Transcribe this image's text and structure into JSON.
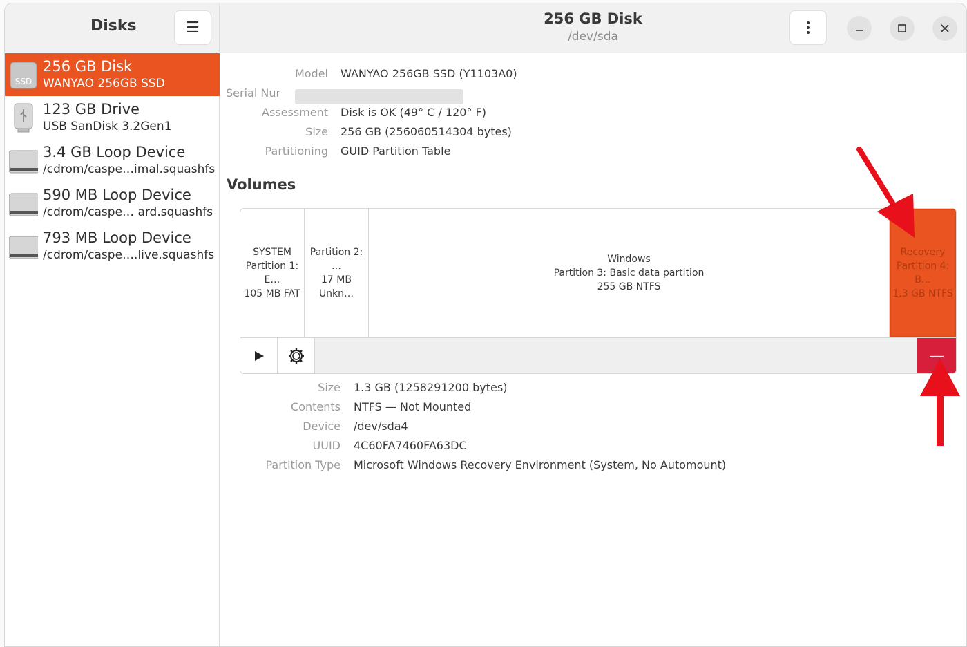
{
  "sidebar": {
    "title": "Disks",
    "drives": [
      {
        "name": "256 GB Disk",
        "sub": "WANYAO 256GB SSD",
        "icon": "ssd-icon",
        "icon_text": "SSD"
      },
      {
        "name": "123 GB Drive",
        "sub": "USB SanDisk 3.2Gen1",
        "icon": "usb-drive-icon"
      },
      {
        "name": "3.4 GB Loop Device",
        "sub": "/cdrom/caspe…imal.squashfs",
        "icon": "loop-device-icon"
      },
      {
        "name": "590 MB Loop Device",
        "sub": "/cdrom/caspe… ard.squashfs",
        "icon": "loop-device-icon"
      },
      {
        "name": "793 MB Loop Device",
        "sub": "/cdrom/caspe….live.squashfs",
        "icon": "loop-device-icon"
      }
    ]
  },
  "header": {
    "title": "256 GB Disk",
    "subtitle": "/dev/sda"
  },
  "disk_info": {
    "model_label": "Model",
    "model_value": "WANYAO 256GB SSD (Y1103A0)",
    "serial_label": "Serial Nur",
    "assessment_label": "Assessment",
    "assessment_value": "Disk is OK (49° C / 120° F)",
    "size_label": "Size",
    "size_value": "256 GB (256060514304 bytes)",
    "partitioning_label": "Partitioning",
    "partitioning_value": "GUID Partition Table"
  },
  "volumes": {
    "title": "Volumes",
    "partitions": [
      {
        "line1": "SYSTEM",
        "line2": "Partition 1: E…",
        "line3": "105 MB FAT"
      },
      {
        "line1": "",
        "line2": "Partition 2: …",
        "line3": "17 MB Unkn…"
      },
      {
        "line1": "Windows",
        "line2": "Partition 3: Basic data partition",
        "line3": "255 GB NTFS"
      },
      {
        "line1": "Recovery",
        "line2": "Partition 4: B…",
        "line3": "1.3 GB NTFS"
      }
    ],
    "delete_label": "—"
  },
  "partition_info": {
    "size_label": "Size",
    "size_value": "1.3 GB (1258291200 bytes)",
    "contents_label": "Contents",
    "contents_value": "NTFS — Not Mounted",
    "device_label": "Device",
    "device_value": "/dev/sda4",
    "uuid_label": "UUID",
    "uuid_value": "4C60FA7460FA63DC",
    "type_label": "Partition Type",
    "type_value": "Microsoft Windows Recovery Environment (System, No Automount)"
  },
  "colors": {
    "accent": "#e95420",
    "delete": "#d71e3a",
    "annotation_arrow": "#e8101a"
  }
}
